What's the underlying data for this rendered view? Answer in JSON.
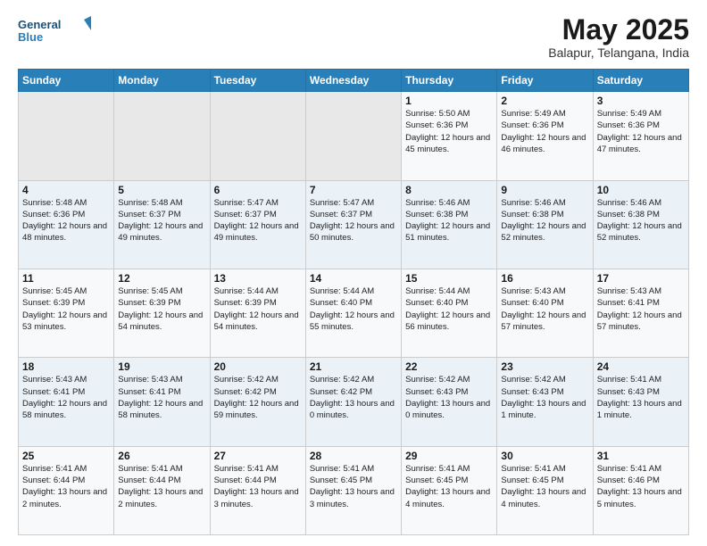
{
  "header": {
    "logo_line1": "General",
    "logo_line2": "Blue",
    "month_title": "May 2025",
    "subtitle": "Balapur, Telangana, India"
  },
  "days_of_week": [
    "Sunday",
    "Monday",
    "Tuesday",
    "Wednesday",
    "Thursday",
    "Friday",
    "Saturday"
  ],
  "weeks": [
    [
      {
        "day": "",
        "empty": true
      },
      {
        "day": "",
        "empty": true
      },
      {
        "day": "",
        "empty": true
      },
      {
        "day": "",
        "empty": true
      },
      {
        "day": "1",
        "sunrise": "5:50 AM",
        "sunset": "6:36 PM",
        "daylight": "12 hours and 45 minutes."
      },
      {
        "day": "2",
        "sunrise": "5:49 AM",
        "sunset": "6:36 PM",
        "daylight": "12 hours and 46 minutes."
      },
      {
        "day": "3",
        "sunrise": "5:49 AM",
        "sunset": "6:36 PM",
        "daylight": "12 hours and 47 minutes."
      }
    ],
    [
      {
        "day": "4",
        "sunrise": "5:48 AM",
        "sunset": "6:36 PM",
        "daylight": "12 hours and 48 minutes."
      },
      {
        "day": "5",
        "sunrise": "5:48 AM",
        "sunset": "6:37 PM",
        "daylight": "12 hours and 49 minutes."
      },
      {
        "day": "6",
        "sunrise": "5:47 AM",
        "sunset": "6:37 PM",
        "daylight": "12 hours and 49 minutes."
      },
      {
        "day": "7",
        "sunrise": "5:47 AM",
        "sunset": "6:37 PM",
        "daylight": "12 hours and 50 minutes."
      },
      {
        "day": "8",
        "sunrise": "5:46 AM",
        "sunset": "6:38 PM",
        "daylight": "12 hours and 51 minutes."
      },
      {
        "day": "9",
        "sunrise": "5:46 AM",
        "sunset": "6:38 PM",
        "daylight": "12 hours and 52 minutes."
      },
      {
        "day": "10",
        "sunrise": "5:46 AM",
        "sunset": "6:38 PM",
        "daylight": "12 hours and 52 minutes."
      }
    ],
    [
      {
        "day": "11",
        "sunrise": "5:45 AM",
        "sunset": "6:39 PM",
        "daylight": "12 hours and 53 minutes."
      },
      {
        "day": "12",
        "sunrise": "5:45 AM",
        "sunset": "6:39 PM",
        "daylight": "12 hours and 54 minutes."
      },
      {
        "day": "13",
        "sunrise": "5:44 AM",
        "sunset": "6:39 PM",
        "daylight": "12 hours and 54 minutes."
      },
      {
        "day": "14",
        "sunrise": "5:44 AM",
        "sunset": "6:40 PM",
        "daylight": "12 hours and 55 minutes."
      },
      {
        "day": "15",
        "sunrise": "5:44 AM",
        "sunset": "6:40 PM",
        "daylight": "12 hours and 56 minutes."
      },
      {
        "day": "16",
        "sunrise": "5:43 AM",
        "sunset": "6:40 PM",
        "daylight": "12 hours and 57 minutes."
      },
      {
        "day": "17",
        "sunrise": "5:43 AM",
        "sunset": "6:41 PM",
        "daylight": "12 hours and 57 minutes."
      }
    ],
    [
      {
        "day": "18",
        "sunrise": "5:43 AM",
        "sunset": "6:41 PM",
        "daylight": "12 hours and 58 minutes."
      },
      {
        "day": "19",
        "sunrise": "5:43 AM",
        "sunset": "6:41 PM",
        "daylight": "12 hours and 58 minutes."
      },
      {
        "day": "20",
        "sunrise": "5:42 AM",
        "sunset": "6:42 PM",
        "daylight": "12 hours and 59 minutes."
      },
      {
        "day": "21",
        "sunrise": "5:42 AM",
        "sunset": "6:42 PM",
        "daylight": "13 hours and 0 minutes."
      },
      {
        "day": "22",
        "sunrise": "5:42 AM",
        "sunset": "6:43 PM",
        "daylight": "13 hours and 0 minutes."
      },
      {
        "day": "23",
        "sunrise": "5:42 AM",
        "sunset": "6:43 PM",
        "daylight": "13 hours and 1 minute."
      },
      {
        "day": "24",
        "sunrise": "5:41 AM",
        "sunset": "6:43 PM",
        "daylight": "13 hours and 1 minute."
      }
    ],
    [
      {
        "day": "25",
        "sunrise": "5:41 AM",
        "sunset": "6:44 PM",
        "daylight": "13 hours and 2 minutes."
      },
      {
        "day": "26",
        "sunrise": "5:41 AM",
        "sunset": "6:44 PM",
        "daylight": "13 hours and 2 minutes."
      },
      {
        "day": "27",
        "sunrise": "5:41 AM",
        "sunset": "6:44 PM",
        "daylight": "13 hours and 3 minutes."
      },
      {
        "day": "28",
        "sunrise": "5:41 AM",
        "sunset": "6:45 PM",
        "daylight": "13 hours and 3 minutes."
      },
      {
        "day": "29",
        "sunrise": "5:41 AM",
        "sunset": "6:45 PM",
        "daylight": "13 hours and 4 minutes."
      },
      {
        "day": "30",
        "sunrise": "5:41 AM",
        "sunset": "6:45 PM",
        "daylight": "13 hours and 4 minutes."
      },
      {
        "day": "31",
        "sunrise": "5:41 AM",
        "sunset": "6:46 PM",
        "daylight": "13 hours and 5 minutes."
      }
    ]
  ],
  "labels": {
    "sunrise": "Sunrise:",
    "sunset": "Sunset:",
    "daylight": "Daylight:"
  }
}
